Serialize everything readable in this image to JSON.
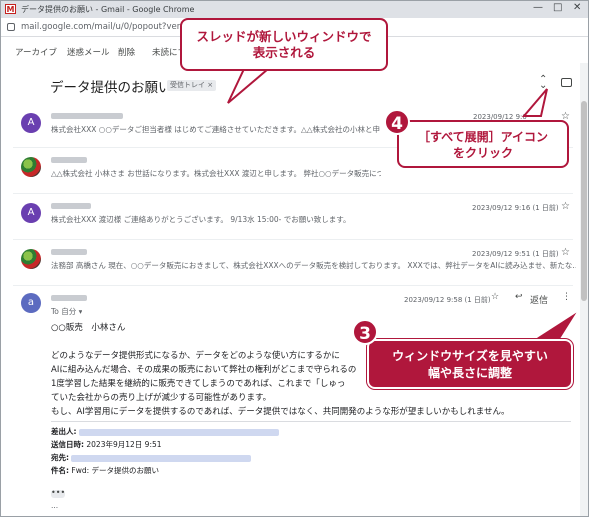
{
  "window": {
    "title": "データ提供のお願い - Gmail - Google Chrome",
    "url": "mail.google.com/mail/u/0/popout?ver=1"
  },
  "toolbar": {
    "archive": "アーカイブ",
    "spam": "迷惑メール",
    "delete": "削除",
    "unread": "未読にする"
  },
  "thread": {
    "subject": "データ提供のお願い",
    "label": "受信トレイ ×"
  },
  "messages": [
    {
      "avatar": "A",
      "snippet": "株式会社XXX ○○データご担当者様 はじめてご連絡させていただきます。△△株式会社の小林と申",
      "date": "2023/09/12 9:0"
    },
    {
      "avatar": "",
      "snippet": "△△株式会社 小林さま お世話になります。株式会社XXX 渡辺と申します。 弊社○○データ販売につきま",
      "date": ""
    },
    {
      "avatar": "A",
      "snippet": "株式会社XXX 渡辺様 ご連絡ありがとうございます。 9/13水 15:00- でお願い致します。",
      "date": "2023/09/12 9:16 (1 日前)"
    },
    {
      "avatar": "",
      "snippet": "法務部 高橋さん 現在、○○データ販売におきまして、株式会社XXXへのデータ販売を検討しております。 XXXでは、弊社データをAIに読み込ませ、新たな…",
      "date": "2023/09/12 9:51 (1 日前)"
    }
  ],
  "open_message": {
    "avatar": "a",
    "to": "To 自分 ▾",
    "date": "2023/09/12 9:58 (1 日前)",
    "reply": "返信",
    "greeting": "○○販売　小林さん",
    "body": [
      "どのようなデータ提供形式になるか、データをどのような使い方にするかに",
      "AIに組み込んだ場合、その成果の販売において弊社の権利がどこまで守られるの",
      "1度学習した結果を継続的に販売できてしまうのであれば、これまで「しゅっ",
      "ていた会社からの売り上げが減少する可能性があります。",
      "もし、AI学習用にデータを提供するのであれば、データ提供ではなく、共同開発のような形が望ましいかもしれません。"
    ],
    "headers": [
      {
        "key": "差出人:",
        "value": ""
      },
      {
        "key": "送信日時:",
        "value": "2023年9月12日 9:51"
      },
      {
        "key": "宛先:",
        "value": ""
      },
      {
        "key": "件名:",
        "value": "Fwd: データ提供のお願い"
      }
    ],
    "more": "•••",
    "trail": "..."
  },
  "callouts": {
    "window_text": "スレッドが新しいウィンドウで\n表示される",
    "step4_num": "4",
    "step4_text": "［すべて展開］アイコン\nをクリック",
    "step3_num": "3",
    "step3_text": "ウィンドウサイズを見やすい\n幅や長さに調整"
  },
  "icons": [
    "gmail-icon",
    "lock-icon",
    "expand-all-icon",
    "print-icon",
    "star-icon",
    "reply-icon",
    "more-vert-icon"
  ]
}
